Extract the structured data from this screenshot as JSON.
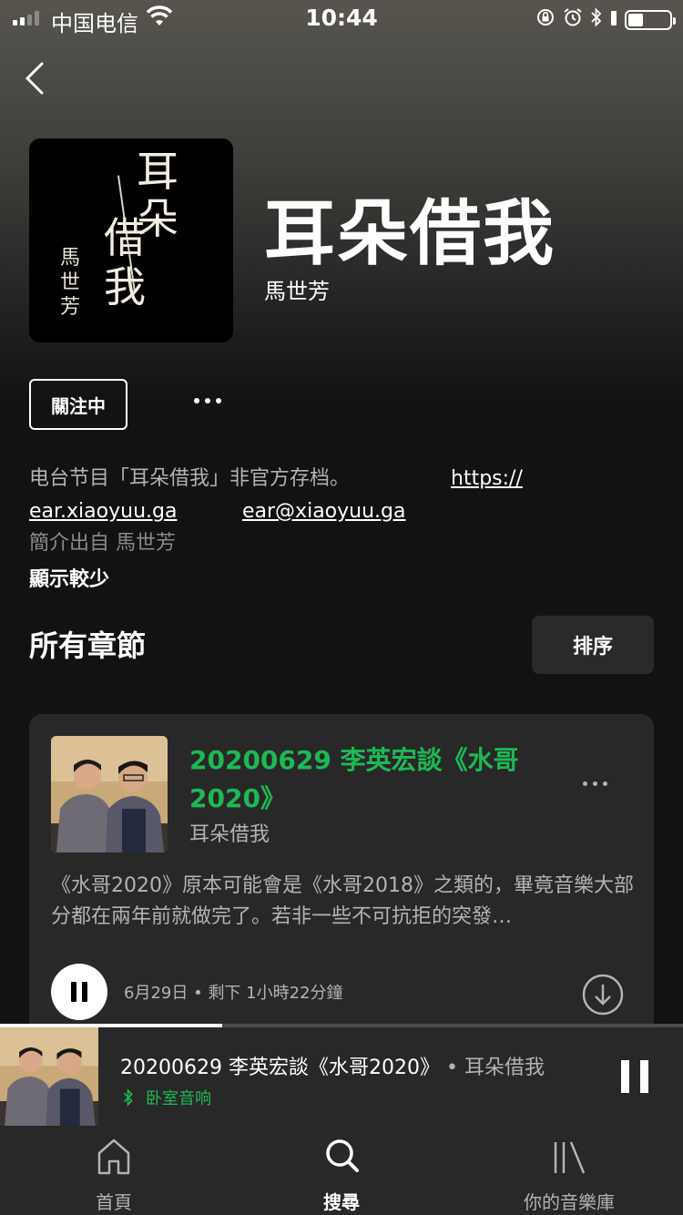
{
  "status_bar": {
    "carrier": "中国电信",
    "time": "10:44"
  },
  "show": {
    "cover_title_1": "耳朵",
    "cover_title_2": "借我",
    "cover_author": "馬世芳",
    "title": "耳朵借我",
    "author": "馬世芳",
    "follow_label": "關注中",
    "description_text": "电台节目「耳朵借我」非官方存档。",
    "url_part1": "https://",
    "url_part2": "ear.xiaoyuu.ga",
    "email": "ear@xiaoyuu.ga",
    "description_credit": "簡介出自 馬世芳",
    "show_less_label": "顯示較少"
  },
  "episodes_section": {
    "title": "所有章節",
    "sort_label": "排序"
  },
  "episode": {
    "title": "20200629 李英宏談《水哥2020》",
    "show": "耳朵借我",
    "description": "《水哥2020》原本可能會是《水哥2018》之類的，畢竟音樂大部分都在兩年前就做完了。若非一些不可抗拒的突發…",
    "date": "6月29日",
    "remaining": "剩下 1小時22分鐘"
  },
  "now_playing": {
    "title": "20200629 李英宏談《水哥2020》",
    "separator": "•",
    "show": "耳朵借我",
    "device": "卧室音响",
    "progress": 0.325
  },
  "tabs": [
    {
      "label": "首頁",
      "icon": "home-icon"
    },
    {
      "label": "搜尋",
      "icon": "search-icon"
    },
    {
      "label": "你的音樂庫",
      "icon": "library-icon"
    }
  ],
  "colors": {
    "accent": "#1db954",
    "background": "#121212",
    "card": "#282828"
  }
}
